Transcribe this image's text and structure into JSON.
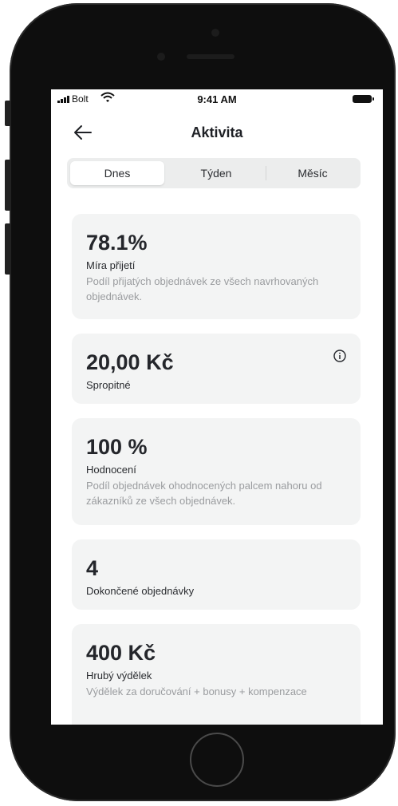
{
  "status_bar": {
    "carrier": "Bolt",
    "time": "9:41 AM"
  },
  "header": {
    "title": "Aktivita"
  },
  "tabs": [
    {
      "label": "Dnes",
      "active": true
    },
    {
      "label": "Týden",
      "active": false
    },
    {
      "label": "Měsíc",
      "active": false
    }
  ],
  "cards": [
    {
      "value": "78.1%",
      "label": "Míra přijetí",
      "description": "Podíl přijatých objednávek ze všech navrhovaných objednávek."
    },
    {
      "value": "20,00 Kč",
      "label": "Spropitné",
      "icon": "info-icon"
    },
    {
      "value": "100 %",
      "label": "Hodnocení",
      "description": "Podíl objednávek ohodnocených palcem nahoru od zákazníků ze všech objednávek."
    },
    {
      "value": "4",
      "label": "Dokončené objednávky"
    },
    {
      "value": "400 Kč",
      "label": "Hrubý výdělek",
      "description": "Výdělek za doručování + bonusy + kompenzace"
    }
  ],
  "colors": {
    "card_background": "#f3f4f4",
    "segment_background": "#eceded",
    "text_primary": "#24262b",
    "text_secondary": "#9a9c9f",
    "device": "#0e0e0e"
  }
}
